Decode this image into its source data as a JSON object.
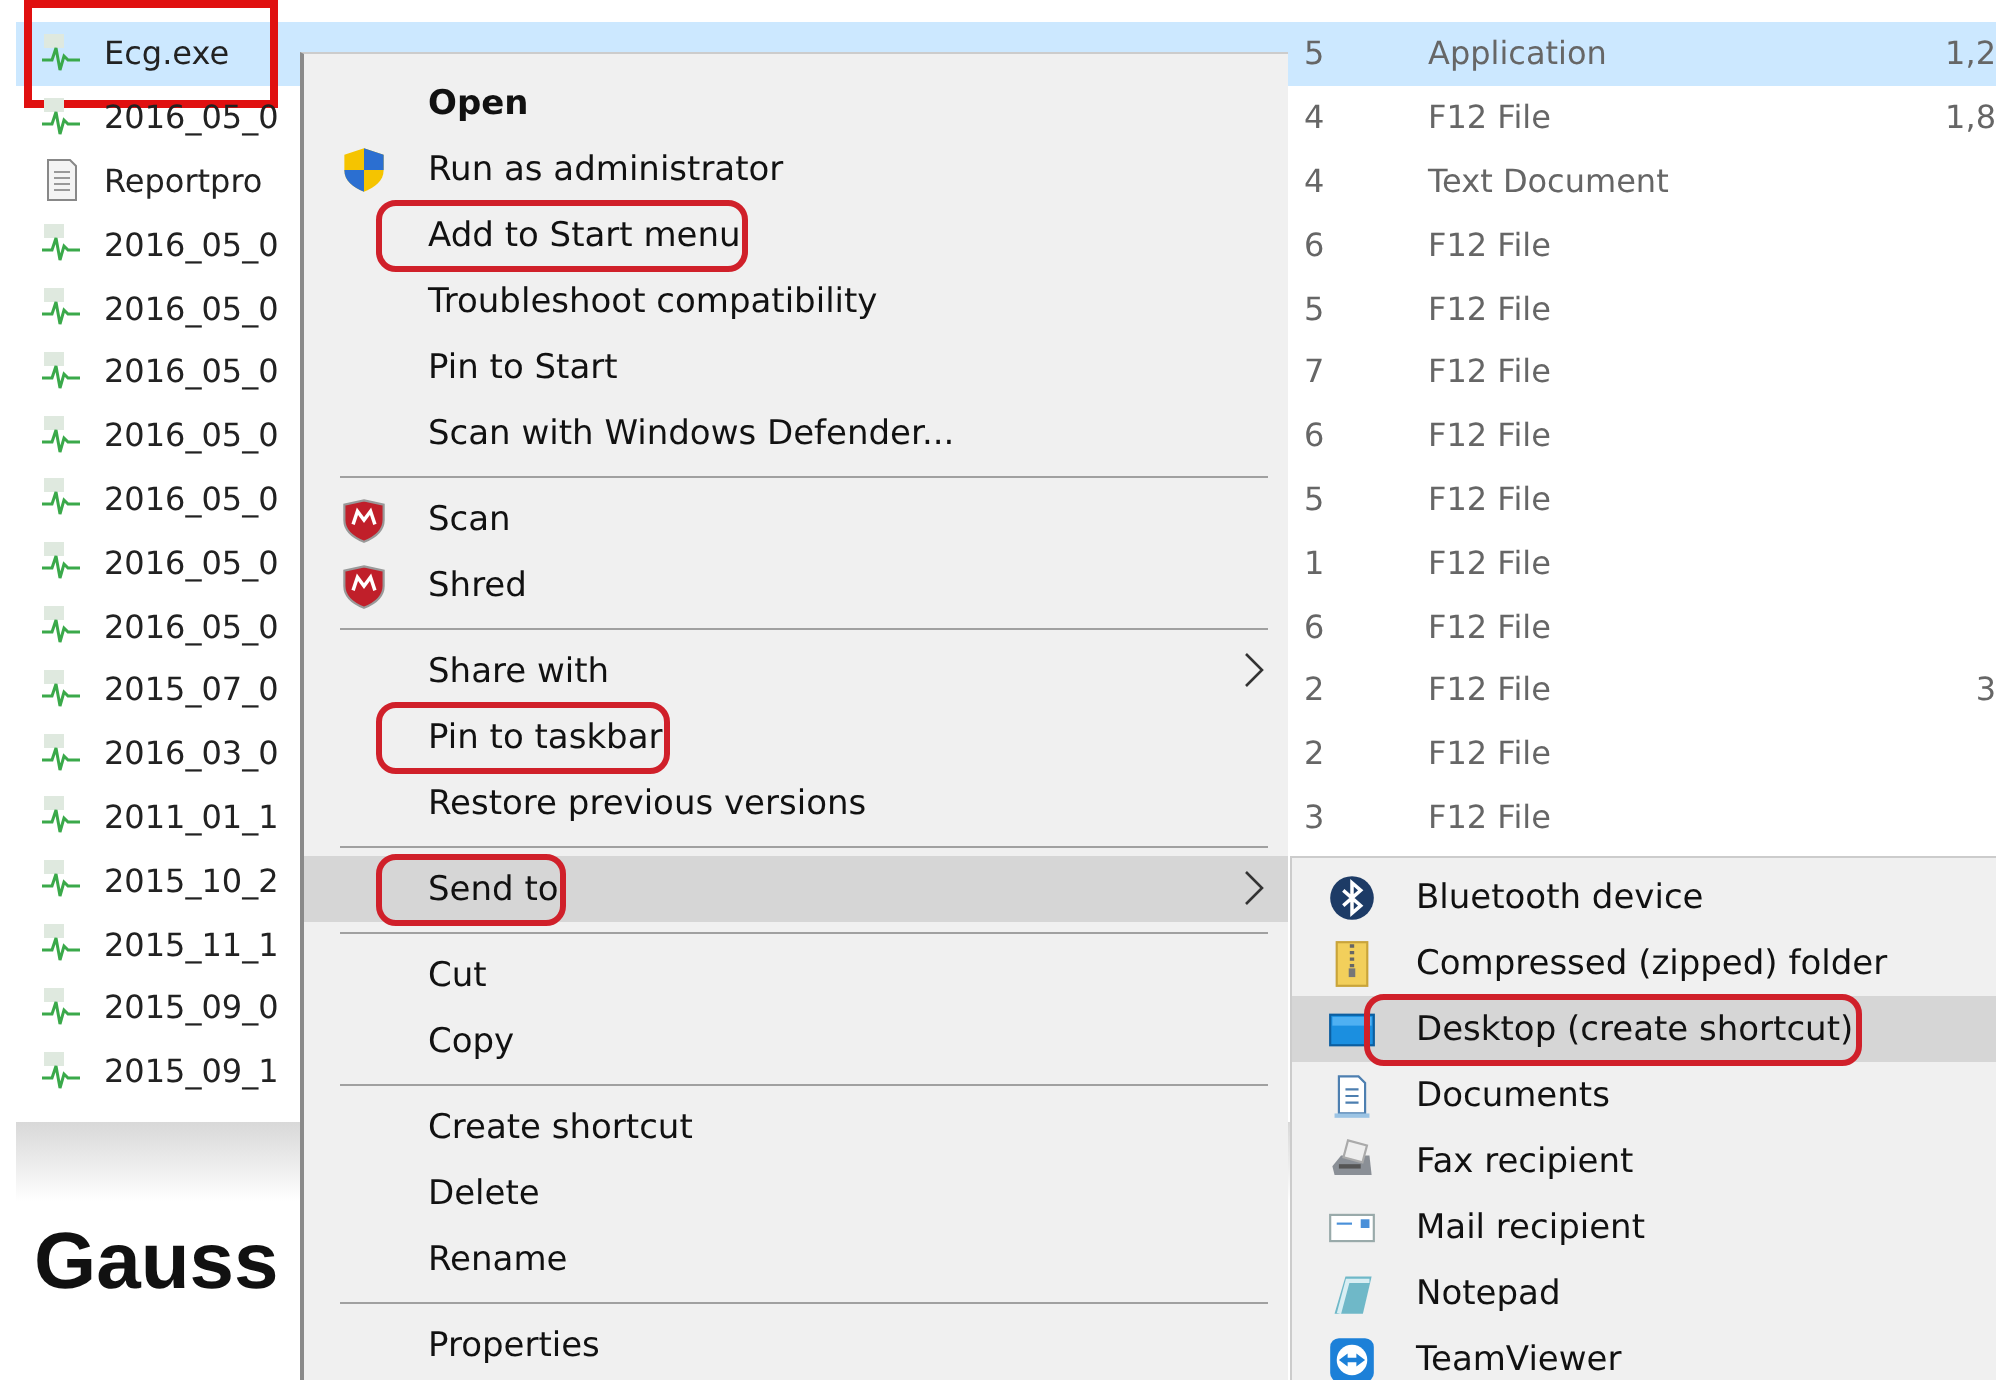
{
  "file_list": {
    "rows": [
      {
        "kind": "ecg",
        "name": "Ecg.exe",
        "date": "5",
        "type": "Application",
        "size": "1,2",
        "selected": true,
        "annotated": true
      },
      {
        "kind": "ecg",
        "name": "2016_05_0",
        "date": "4",
        "type": "F12 File",
        "size": "1,8",
        "selected": false,
        "annotated": false
      },
      {
        "kind": "text",
        "name": "Reportpro",
        "date": "4",
        "type": "Text Document",
        "selected": false,
        "annotated": false
      },
      {
        "kind": "ecg",
        "name": "2016_05_0",
        "date": "6",
        "type": "F12 File",
        "selected": false,
        "annotated": false
      },
      {
        "kind": "ecg",
        "name": "2016_05_0",
        "date": "5",
        "type": "F12 File",
        "selected": false,
        "annotated": false
      },
      {
        "kind": "ecg",
        "name": "2016_05_0",
        "date": "7",
        "type": "F12 File",
        "selected": false,
        "annotated": false
      },
      {
        "kind": "ecg",
        "name": "2016_05_0",
        "date": "6",
        "type": "F12 File",
        "selected": false,
        "annotated": false
      },
      {
        "kind": "ecg",
        "name": "2016_05_0",
        "date": "5",
        "type": "F12 File",
        "selected": false,
        "annotated": false
      },
      {
        "kind": "ecg",
        "name": "2016_05_0",
        "date": "1",
        "type": "F12 File",
        "selected": false,
        "annotated": false
      },
      {
        "kind": "ecg",
        "name": "2016_05_0",
        "date": "6",
        "type": "F12 File",
        "selected": false,
        "annotated": false
      },
      {
        "kind": "ecg",
        "name": "2015_07_0",
        "date": "2",
        "type": "F12 File",
        "size": "3",
        "selected": false,
        "annotated": false
      },
      {
        "kind": "ecg",
        "name": "2016_03_0",
        "date": "2",
        "type": "F12 File",
        "selected": false,
        "annotated": false
      },
      {
        "kind": "ecg",
        "name": "2011_01_1",
        "date": "3",
        "type": "F12 File",
        "selected": false,
        "annotated": false
      },
      {
        "kind": "ecg",
        "name": "2015_10_2",
        "selected": false,
        "annotated": false
      },
      {
        "kind": "ecg",
        "name": "2015_11_1",
        "selected": false,
        "annotated": false
      },
      {
        "kind": "ecg",
        "name": "2015_09_0",
        "selected": false,
        "annotated": false
      },
      {
        "kind": "ecg",
        "name": "2015_09_1",
        "selected": false,
        "annotated": false
      }
    ]
  },
  "heading": "Gauss",
  "context_menu": {
    "groups": [
      [
        {
          "label": "Open",
          "bold": true,
          "selected": false,
          "annotated": false,
          "submenu": false
        },
        {
          "label": "Run as administrator",
          "kind": "shield",
          "bold": false,
          "selected": false,
          "annotated": false,
          "submenu": false
        },
        {
          "label": "Add to Start menu",
          "bold": false,
          "selected": false,
          "annotated": true,
          "submenu": false
        },
        {
          "label": "Troubleshoot compatibility",
          "bold": false,
          "selected": false,
          "annotated": false,
          "submenu": false
        },
        {
          "label": "Pin to Start",
          "bold": false,
          "selected": false,
          "annotated": false,
          "submenu": false
        },
        {
          "label": "Scan with Windows Defender...",
          "bold": false,
          "selected": false,
          "annotated": false,
          "submenu": false
        }
      ],
      [
        {
          "label": "Scan",
          "kind": "antivirus",
          "bold": false,
          "selected": false,
          "annotated": false,
          "submenu": false
        },
        {
          "label": "Shred",
          "kind": "antivirus",
          "bold": false,
          "selected": false,
          "annotated": false,
          "submenu": false
        }
      ],
      [
        {
          "label": "Share with",
          "bold": false,
          "selected": false,
          "annotated": false,
          "submenu": true
        },
        {
          "label": "Pin to taskbar",
          "bold": false,
          "selected": false,
          "annotated": true,
          "submenu": false
        },
        {
          "label": "Restore previous versions",
          "bold": false,
          "selected": false,
          "annotated": false,
          "submenu": false
        }
      ],
      [
        {
          "label": "Send to",
          "bold": false,
          "selected": true,
          "annotated": true,
          "submenu": true
        }
      ],
      [
        {
          "label": "Cut",
          "bold": false,
          "selected": false,
          "annotated": false,
          "submenu": false
        },
        {
          "label": "Copy",
          "bold": false,
          "selected": false,
          "annotated": false,
          "submenu": false
        }
      ],
      [
        {
          "label": "Create shortcut",
          "bold": false,
          "selected": false,
          "annotated": false,
          "submenu": false
        },
        {
          "label": "Delete",
          "bold": false,
          "selected": false,
          "annotated": false,
          "submenu": false
        },
        {
          "label": "Rename",
          "bold": false,
          "selected": false,
          "annotated": false,
          "submenu": false
        }
      ],
      [
        {
          "label": "Properties",
          "bold": false,
          "selected": false,
          "annotated": false,
          "submenu": false
        }
      ]
    ]
  },
  "send_to_menu": {
    "items": [
      {
        "label": "Bluetooth device",
        "kind": "bluetooth",
        "selected": false,
        "annotated": false
      },
      {
        "label": "Compressed (zipped) folder",
        "kind": "zip",
        "selected": false,
        "annotated": false
      },
      {
        "label": "Desktop (create shortcut)",
        "kind": "desktop",
        "selected": true,
        "annotated": true
      },
      {
        "label": "Documents",
        "kind": "documents",
        "selected": false,
        "annotated": false
      },
      {
        "label": "Fax recipient",
        "kind": "fax",
        "selected": false,
        "annotated": false
      },
      {
        "label": "Mail recipient",
        "kind": "mail",
        "selected": false,
        "annotated": false
      },
      {
        "label": "Notepad",
        "kind": "notepad",
        "selected": false,
        "annotated": false
      },
      {
        "label": "TeamViewer",
        "kind": "teamviewer",
        "selected": false,
        "annotated": false
      }
    ]
  }
}
